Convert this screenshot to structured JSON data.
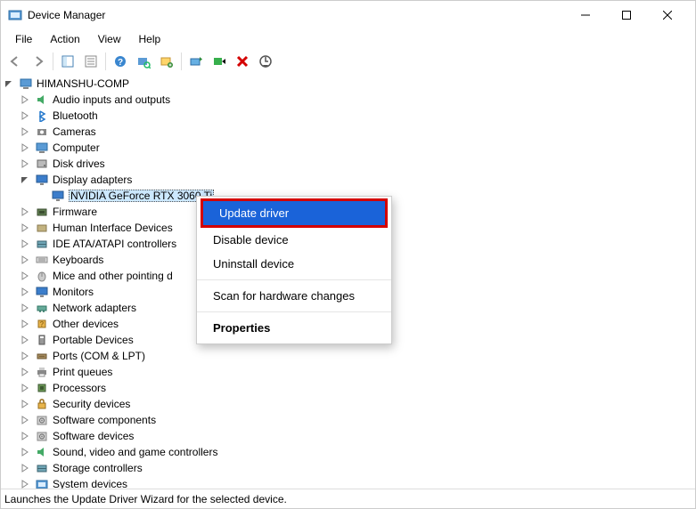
{
  "window": {
    "title": "Device Manager"
  },
  "menu": {
    "file": "File",
    "action": "Action",
    "view": "View",
    "help": "Help"
  },
  "tree": {
    "root": "HIMANSHU-COMP",
    "items": [
      "Audio inputs and outputs",
      "Bluetooth",
      "Cameras",
      "Computer",
      "Disk drives",
      "Display adapters",
      "Firmware",
      "Human Interface Devices",
      "IDE ATA/ATAPI controllers",
      "Keyboards",
      "Mice and other pointing d",
      "Monitors",
      "Network adapters",
      "Other devices",
      "Portable Devices",
      "Ports (COM & LPT)",
      "Print queues",
      "Processors",
      "Security devices",
      "Software components",
      "Software devices",
      "Sound, video and game controllers",
      "Storage controllers",
      "System devices"
    ],
    "expanded_item_index": 5,
    "selected_child": "NVIDIA GeForce RTX 3060 Ti"
  },
  "context_menu": {
    "update_driver": "Update driver",
    "disable_device": "Disable device",
    "uninstall_device": "Uninstall device",
    "scan_hardware": "Scan for hardware changes",
    "properties": "Properties"
  },
  "statusbar": {
    "text": "Launches the Update Driver Wizard for the selected device."
  },
  "colors": {
    "selection_bg": "#cce8ff",
    "ctx_highlight_bg": "#1a63d9",
    "highlight_border": "#d40000"
  }
}
